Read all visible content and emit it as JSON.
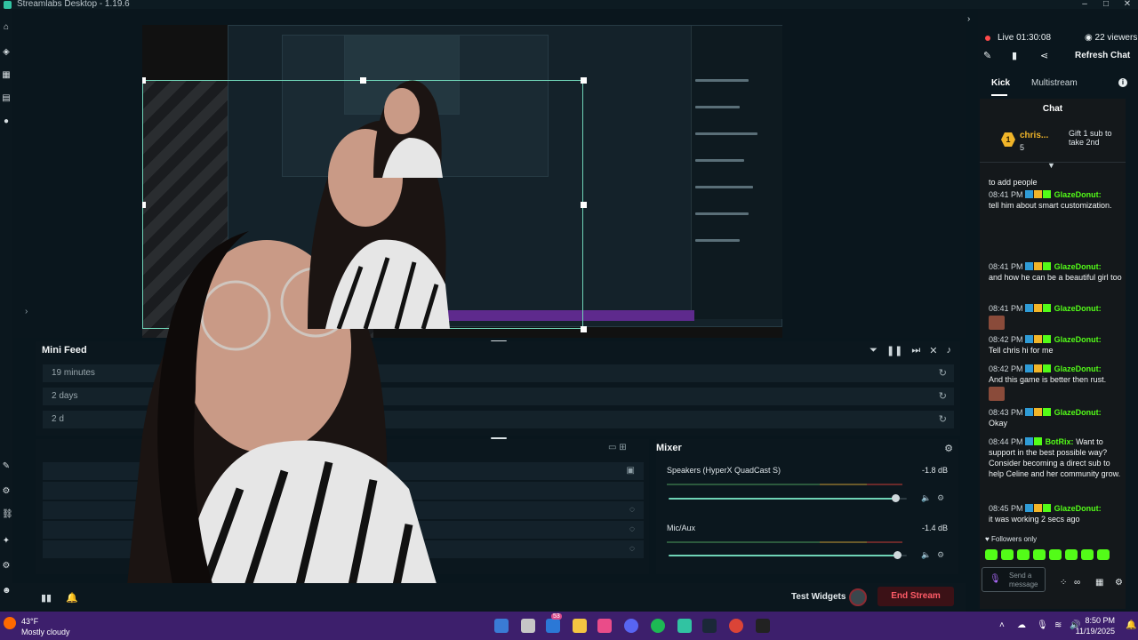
{
  "window": {
    "title": "Streamlabs Desktop - 1.19.6"
  },
  "mini_feed": {
    "title": "Mini Feed",
    "rows": [
      "19 minutes",
      "2 days",
      "2 d"
    ]
  },
  "mixer": {
    "title": "Mixer",
    "channels": [
      {
        "name": "Speakers (HyperX QuadCast S)",
        "db": "-1.8 dB",
        "level": 0.95
      },
      {
        "name": "Mic/Aux",
        "db": "-1.4 dB",
        "level": 0.96
      }
    ]
  },
  "bottom_bar": {
    "test_widgets": "Test Widgets",
    "end_stream": "End Stream"
  },
  "stream_status": {
    "live": "Live 01:30:08",
    "viewers": "22 viewers",
    "refresh_chat": "Refresh Chat"
  },
  "tabs": [
    {
      "label": "Kick"
    },
    {
      "label": "Multistream"
    }
  ],
  "chat": {
    "title": "Chat",
    "pinned": {
      "user": "chris...",
      "count": "5",
      "badge": "1",
      "cta": "Gift 1 sub to take 2nd"
    },
    "messages": [
      {
        "time": "",
        "user": "",
        "text": "to add people"
      },
      {
        "time": "08:41 PM",
        "user": "GlazeDonut:",
        "text": "tell him about smart customization."
      },
      {
        "time": "08:41 PM",
        "user": "GlazeDonut:",
        "text": "and how he can be a beautiful girl too"
      },
      {
        "time": "08:41 PM",
        "user": "GlazeDonut:",
        "text": ""
      },
      {
        "time": "08:42 PM",
        "user": "GlazeDonut:",
        "text": "Tell chris hi for me"
      },
      {
        "time": "08:42 PM",
        "user": "GlazeDonut:",
        "text": "And this game is better then rust."
      },
      {
        "time": "08:43 PM",
        "user": "GlazeDonut:",
        "text": "Okay"
      },
      {
        "time": "08:44 PM",
        "user": "BotRix:",
        "text": "Want to support in the best possible way? Consider becoming a direct sub to help Celine and her community grow."
      },
      {
        "time": "08:45 PM",
        "user": "GlazeDonut:",
        "text": "it was working 2 secs ago"
      }
    ],
    "first_time": "08:41 PM",
    "first_user": "GlazeDonut:",
    "followers_only": "Followers only",
    "input_placeholder": "Send a message"
  },
  "taskbar": {
    "weather_temp": "43°F",
    "weather_cond": "Mostly cloudy",
    "time": "8:50 PM",
    "date": "11/19/2025",
    "badge_count": "53"
  },
  "colors": {
    "accent": "#6fd3b6",
    "kick_green": "#53fc18",
    "end_stream": "#ff5b67",
    "taskbar": "#3d1f6c"
  }
}
